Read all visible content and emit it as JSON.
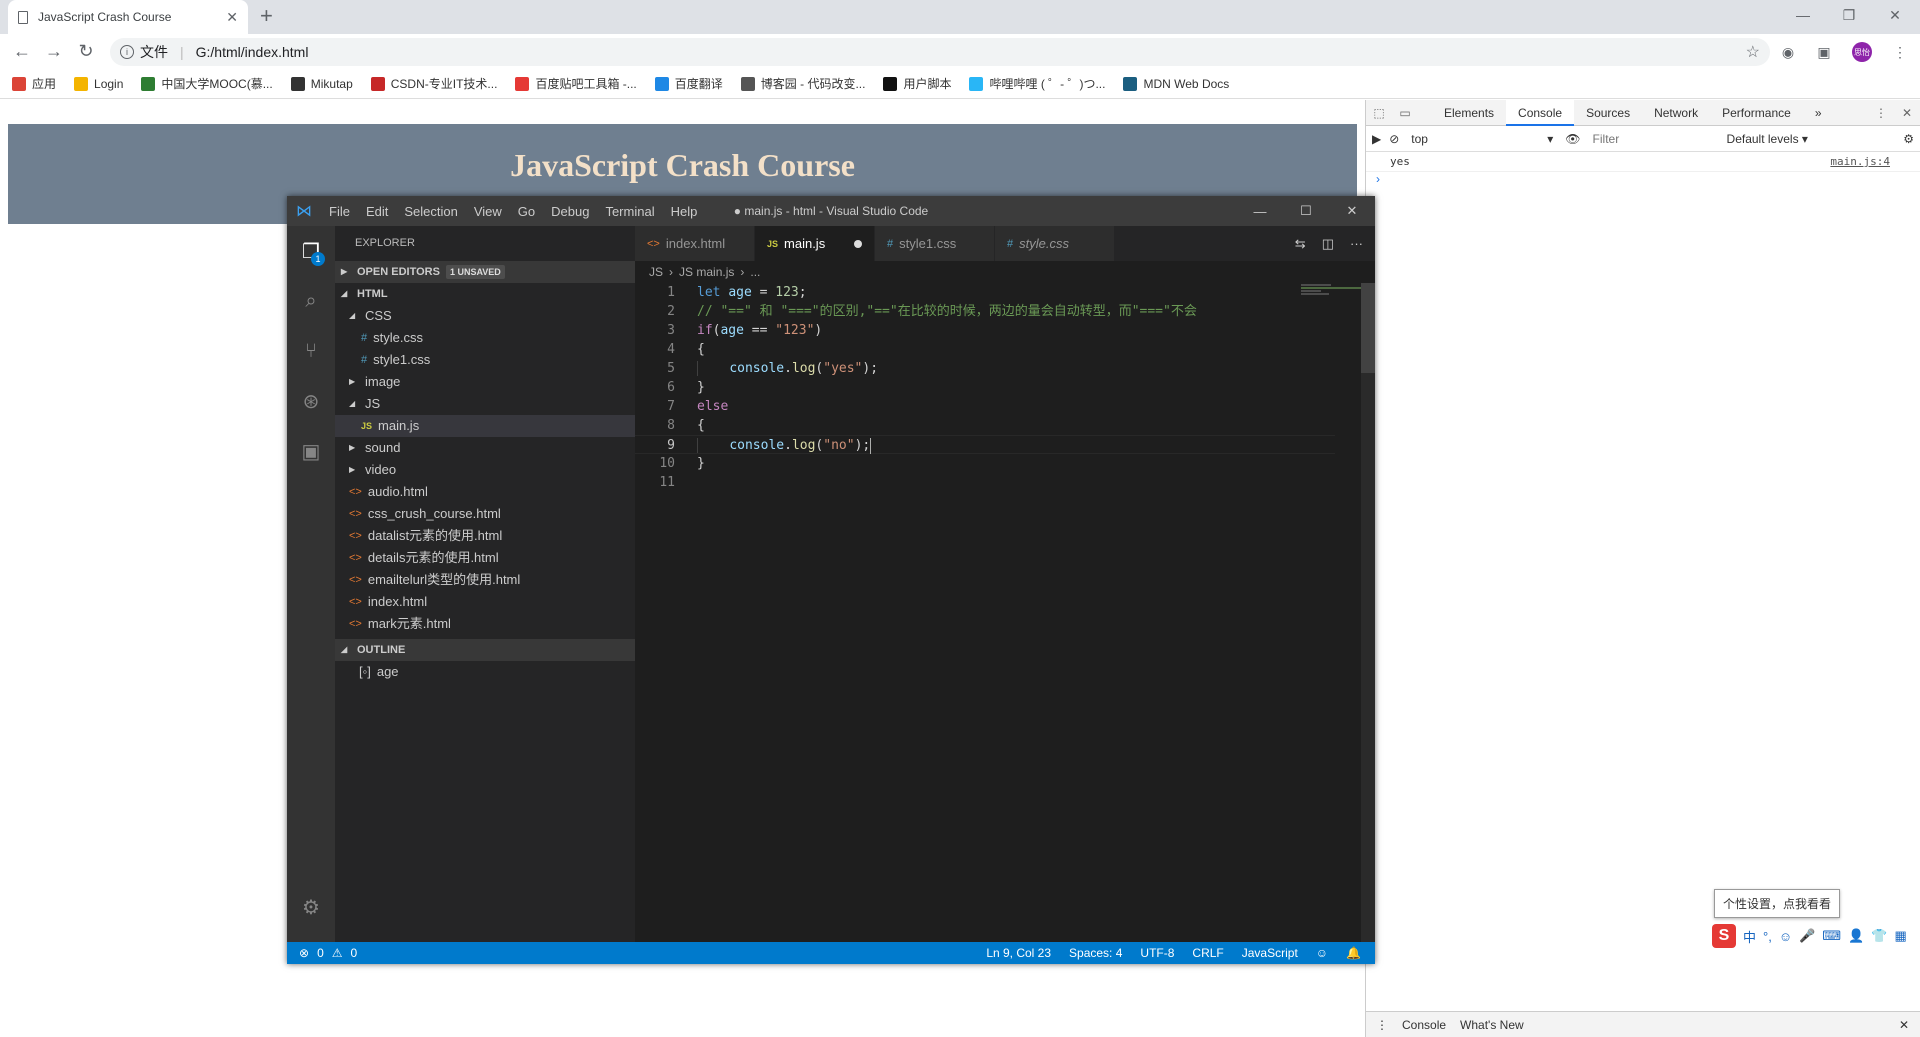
{
  "browser": {
    "tab_title": "JavaScript Crash Course",
    "url_prefix": "文件",
    "url": "G:/html/index.html",
    "avatar_text": "思怡",
    "bookmarks": [
      {
        "label": "应用",
        "color": "#db4437"
      },
      {
        "label": "Login",
        "color": "#f4b400"
      },
      {
        "label": "中国大学MOOC(慕...",
        "color": "#2e7d32"
      },
      {
        "label": "Mikutap",
        "color": "#333333"
      },
      {
        "label": "CSDN-专业IT技术...",
        "color": "#c62828"
      },
      {
        "label": "百度贴吧工具箱 -...",
        "color": "#e53935"
      },
      {
        "label": "百度翻译",
        "color": "#1e88e5"
      },
      {
        "label": "博客园 - 代码改变...",
        "color": "#555555"
      },
      {
        "label": "用户脚本",
        "color": "#111111"
      },
      {
        "label": "哔哩哔哩 ( ゜- ゜)つ...",
        "color": "#29b6f6"
      },
      {
        "label": "MDN Web Docs",
        "color": "#1b5e80"
      }
    ]
  },
  "page": {
    "header_title": "JavaScript Crash Course"
  },
  "devtools": {
    "tabs": [
      "Elements",
      "Console",
      "Sources",
      "Network",
      "Performance"
    ],
    "active_tab": "Console",
    "more_tabs": "»",
    "context": "top",
    "filter_placeholder": "Filter",
    "levels": "Default levels ▾",
    "console_lines": [
      {
        "text": "yes",
        "source": "main.js:4"
      }
    ],
    "prompt": "›",
    "drawer_tabs": [
      "Console",
      "What's New"
    ]
  },
  "ime": {
    "tip": "个性设置，点我看看",
    "logo": "S",
    "items": [
      "中",
      "°,",
      "☺",
      "🎤",
      "⌨",
      "👤",
      "👕",
      "▦"
    ]
  },
  "vscode": {
    "window_title": "● main.js - html - Visual Studio Code",
    "menu": [
      "File",
      "Edit",
      "Selection",
      "View",
      "Go",
      "Debug",
      "Terminal",
      "Help"
    ],
    "activity_badge": "1",
    "explorer_title": "EXPLORER",
    "open_editors_label": "OPEN EDITORS",
    "unsaved_badge": "1 UNSAVED",
    "root_label": "HTML",
    "tree": [
      {
        "label": "CSS",
        "type": "folder-open",
        "depth": 1
      },
      {
        "label": "style.css",
        "type": "css",
        "depth": 2
      },
      {
        "label": "style1.css",
        "type": "css",
        "depth": 2
      },
      {
        "label": "image",
        "type": "folder",
        "depth": 1
      },
      {
        "label": "JS",
        "type": "folder-open",
        "depth": 1
      },
      {
        "label": "main.js",
        "type": "js",
        "depth": 2,
        "selected": true
      },
      {
        "label": "sound",
        "type": "folder",
        "depth": 1
      },
      {
        "label": "video",
        "type": "folder",
        "depth": 1
      },
      {
        "label": "audio.html",
        "type": "html",
        "depth": 1
      },
      {
        "label": "css_crush_course.html",
        "type": "html",
        "depth": 1
      },
      {
        "label": "datalist元素的使用.html",
        "type": "html",
        "depth": 1
      },
      {
        "label": "details元素的使用.html",
        "type": "html",
        "depth": 1
      },
      {
        "label": "emailtelurl类型的使用.html",
        "type": "html",
        "depth": 1
      },
      {
        "label": "index.html",
        "type": "html",
        "depth": 1
      },
      {
        "label": "mark元素.html",
        "type": "html",
        "depth": 1
      }
    ],
    "outline_label": "OUTLINE",
    "outline_items": [
      "age"
    ],
    "editor_tabs": [
      {
        "label": "index.html",
        "icon": "<>",
        "kind": "html"
      },
      {
        "label": "main.js",
        "icon": "JS",
        "kind": "js",
        "active": true,
        "dirty": true
      },
      {
        "label": "style1.css",
        "icon": "#",
        "kind": "css"
      },
      {
        "label": "style.css",
        "icon": "#",
        "kind": "css",
        "italic": true
      }
    ],
    "breadcrumbs": [
      "JS",
      "JS main.js",
      "..."
    ],
    "code_lines": [
      "<span class=\"kw\">let</span> <span class=\"var\">age</span> = <span class=\"num\">123</span>;",
      "<span class=\"cmt\">// \"==\" 和 \"===\"的区别,\"==\"在比较的时候，两边的量会自动转型，而\"===\"不会</span>",
      "<span class=\"kw2\">if</span>(<span class=\"var\">age</span> == <span class=\"str\">\"123\"</span>)",
      "{",
      "<span class=\"indent\"></span>    <span class=\"var\">console</span>.<span class=\"fn\">log</span>(<span class=\"str\">\"yes\"</span>);",
      "}",
      "<span class=\"kw2\">else</span>",
      "{",
      "<span class=\"indent\"></span>    <span class=\"var\">console</span>.<span class=\"fn\">log</span>(<span class=\"str\">\"no\"</span>);<span class=\"cursor\"></span>",
      "}",
      ""
    ],
    "current_line": 9,
    "status": {
      "errors": "0",
      "warnings": "0",
      "position": "Ln 9, Col 23",
      "spaces": "Spaces: 4",
      "encoding": "UTF-8",
      "eol": "CRLF",
      "language": "JavaScript"
    }
  }
}
